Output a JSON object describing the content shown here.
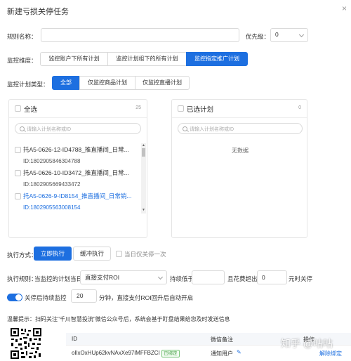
{
  "dialog": {
    "title": "新建亏损关停任务",
    "close_glyph": "×"
  },
  "rule_name": {
    "label": "规则名称：",
    "value": "",
    "placeholder": ""
  },
  "priority": {
    "label": "优先级：",
    "value": "0"
  },
  "dimension": {
    "label": "监控维度：",
    "options": [
      "监控账户下所有计划",
      "监控计划组下的所有计划",
      "监控指定推广计划"
    ],
    "selected_index": 2
  },
  "plan_type": {
    "label": "监控计划类型：",
    "options": [
      "全部",
      "仅监控商品计划",
      "仅监控直播计划"
    ],
    "selected_index": 0
  },
  "left_panel": {
    "select_all": "全选",
    "count": "25",
    "search_placeholder": "请输入计划名称或ID",
    "items": [
      {
        "name": "托A5-0626-12-ID4788_推直播间_日常...",
        "id": "ID:1802905846304788",
        "highlight": false
      },
      {
        "name": "托A5-0626-10-ID3472_推直播间_日常...",
        "id": "ID:1802905669433472",
        "highlight": false
      },
      {
        "name": "托A5-0626-9-ID8154_推直播间_日常销...",
        "id": "ID:1802905563008154",
        "highlight": true
      }
    ]
  },
  "right_panel": {
    "title": "已选计划",
    "count": "0",
    "search_placeholder": "请输入计划名称或ID",
    "empty_text": "无数据"
  },
  "exec_mode": {
    "label": "执行方式：",
    "options": [
      "立即执行",
      "缓冲执行"
    ],
    "selected_index": 0,
    "once_label": "当日仅关停一次"
  },
  "exec_rule": {
    "label": "执行规则：",
    "prefix": "当监控的计划当日",
    "metric": "直接支付ROI",
    "mid_text": "持续低于",
    "threshold": "",
    "spend_text": "且花费超出",
    "spend_value": "0",
    "suffix": "元时关停"
  },
  "auto_resume": {
    "label": "关停后持续监控",
    "minutes": "20",
    "suffix": "分钟，直接支付ROI回升后自动开启"
  },
  "tip": {
    "text": "温馨提示：扫码关注\"千川智慧投流\"微信公众号后，系统会基于盯盘结果给您及时发送信息"
  },
  "table": {
    "headers": [
      "ID",
      "微信备注",
      "操作"
    ],
    "rows": [
      {
        "id": "oIlxOxHUp62kvNAxXe97lMFFBZCI",
        "tag": "已绑定",
        "note": "通知用户",
        "action": "解除绑定"
      }
    ]
  },
  "watermark": "知乎 @咕咕",
  "colors": {
    "primary": "#1d6fe0",
    "success": "#4aa34a"
  }
}
